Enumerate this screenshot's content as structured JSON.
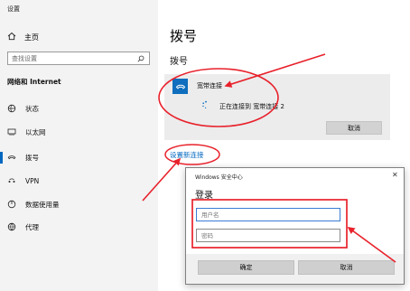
{
  "app": {
    "title": "设置"
  },
  "sidebar": {
    "home_label": "主页",
    "search_placeholder": "查找设置",
    "section_heading": "网络和 Internet",
    "items": [
      {
        "label": "状态",
        "icon": "globe-status-icon"
      },
      {
        "label": "以太网",
        "icon": "ethernet-icon"
      },
      {
        "label": "拨号",
        "icon": "dialup-icon",
        "active": true
      },
      {
        "label": "VPN",
        "icon": "vpn-icon"
      },
      {
        "label": "数据使用量",
        "icon": "data-usage-icon"
      },
      {
        "label": "代理",
        "icon": "proxy-globe-icon"
      }
    ]
  },
  "main": {
    "page_title": "拨号",
    "section_title": "拨号",
    "connection": {
      "name": "宽带连接",
      "status": "正在连接到 宽带连接 2",
      "cancel_label": "取消"
    },
    "setup_link": "设置新连接"
  },
  "dialog": {
    "title": "Windows 安全中心",
    "close_glyph": "✕",
    "heading": "登录",
    "username_placeholder": "用户名",
    "password_placeholder": "密码",
    "ok_label": "确定",
    "cancel_label": "取消"
  },
  "colors": {
    "accent": "#0067c0",
    "annotation": "#e8212b",
    "sidebar_bg": "#f3f3f3",
    "card_bg": "#ececec"
  }
}
